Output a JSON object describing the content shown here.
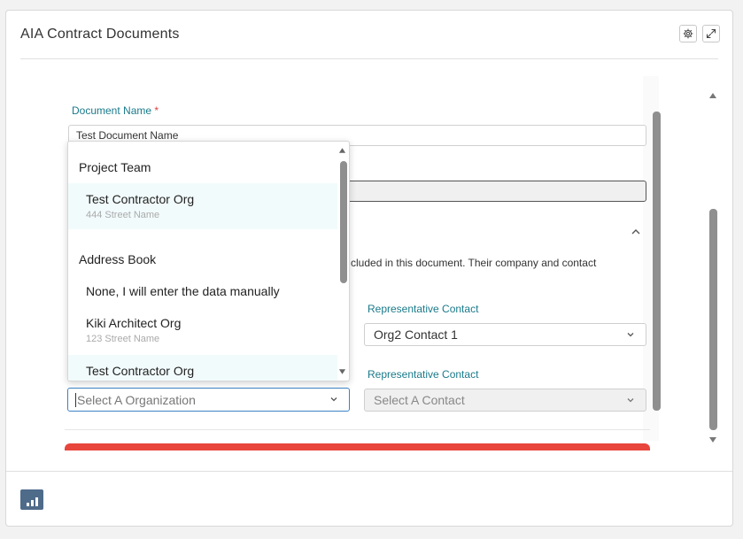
{
  "header": {
    "title": "AIA Contract Documents",
    "settings_icon": "gear-icon",
    "expand_icon": "expand-icon"
  },
  "form": {
    "document_name_label": "Document Name",
    "required_marker": "*",
    "document_name_value": "Test Document Name",
    "section_text": "cluded in this document. Their company and contact",
    "rep_contact_label_1": "Representative Contact",
    "rep_contact_value_1": "Org2 Contact 1",
    "rep_contact_label_2": "Representative Contact",
    "org_select_placeholder": "Select A Organization",
    "contact_select_placeholder": "Select A Contact"
  },
  "dropdown": {
    "groups": [
      {
        "label": "Project Team",
        "items": [
          {
            "name": "Test Contractor Org",
            "address": "444 Street Name"
          }
        ]
      },
      {
        "label": "Address Book",
        "items": [
          {
            "name": "None, I will enter the data manually",
            "address": ""
          },
          {
            "name": "Kiki Architect Org",
            "address": "123 Street Name"
          },
          {
            "name": "Test Contractor Org",
            "address": ""
          }
        ]
      }
    ]
  },
  "colors": {
    "label_teal": "#1a7a8a",
    "required_red": "#e04040",
    "accent_blue": "#3b82c4",
    "danger_bar": "#e8453c",
    "chart_button": "#4f6b8a"
  },
  "footer": {
    "chart_icon": "bar-chart-icon"
  }
}
